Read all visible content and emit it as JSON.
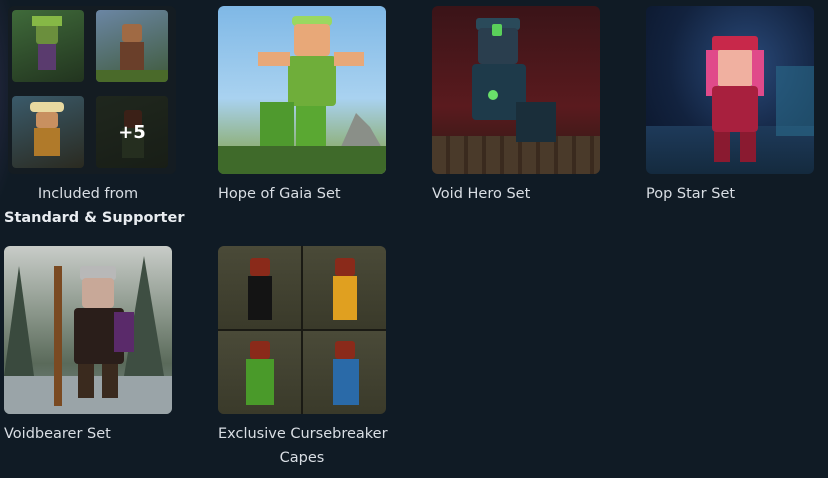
{
  "sets": [
    {
      "id": "included",
      "label_line1": "Included from",
      "label_line2": "Standard & Supporter",
      "more_badge": "+5"
    },
    {
      "id": "hope-of-gaia",
      "label": "Hope of Gaia Set"
    },
    {
      "id": "void-hero",
      "label": "Void Hero Set"
    },
    {
      "id": "pop-star",
      "label": "Pop Star Set"
    },
    {
      "id": "voidbearer",
      "label": "Voidbearer Set"
    },
    {
      "id": "cursebreaker",
      "label_line1": "Exclusive Cursebreaker",
      "label_line2": "Capes"
    }
  ],
  "colors": {
    "background": "#101b25",
    "text": "#d9dee4"
  }
}
